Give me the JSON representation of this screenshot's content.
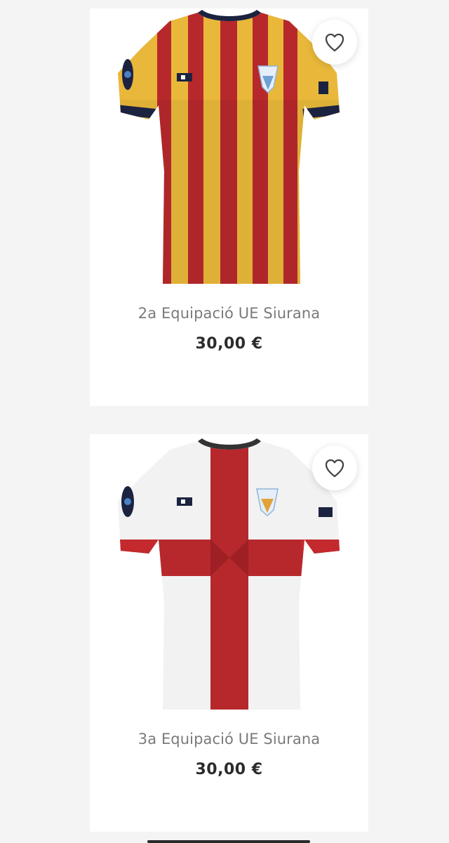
{
  "products": [
    {
      "name": "2a Equipació UE Siurana",
      "price": "30,00 €",
      "image": "yellow-red-striped-jersey",
      "wishlist_icon": "heart-outline-icon"
    },
    {
      "name": "3a Equipació UE Siurana",
      "price": "30,00 €",
      "image": "white-jersey-red-cross",
      "wishlist_icon": "heart-outline-icon"
    }
  ],
  "colors": {
    "background": "#f4f4f4",
    "card": "#ffffff",
    "name_text": "#7a7a7a",
    "price_text": "#2b2b2b",
    "jersey_yellow": "#e9b83a",
    "jersey_red": "#b7282c",
    "jersey_navy": "#1c2340"
  }
}
